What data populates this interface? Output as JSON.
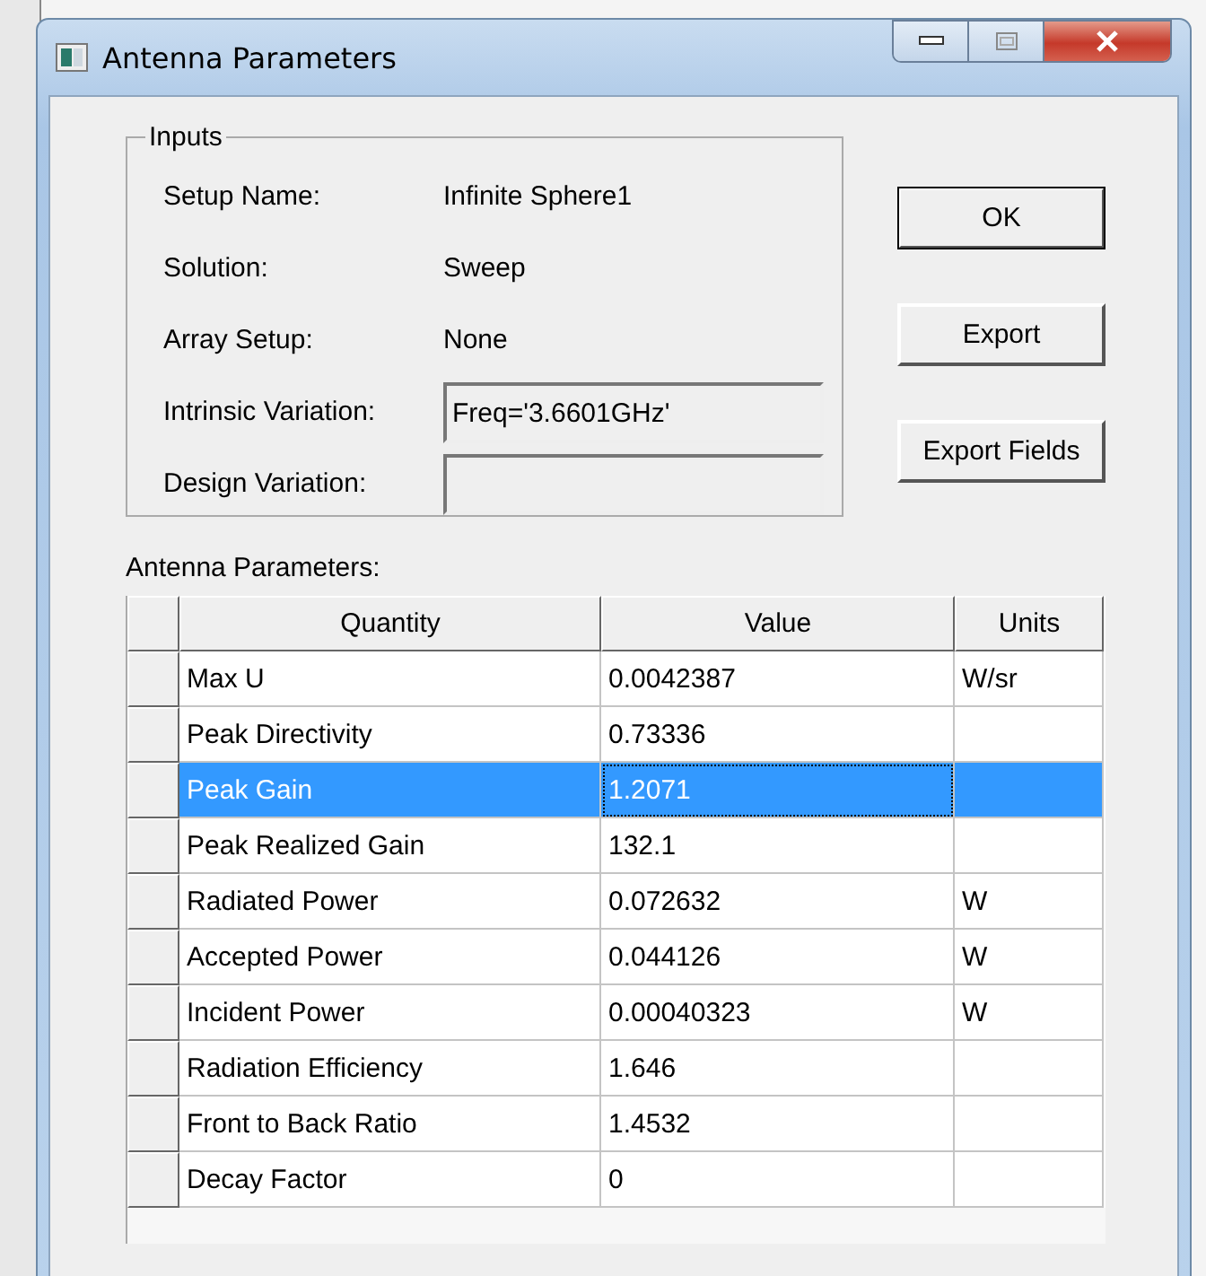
{
  "window": {
    "title": "Antenna Parameters"
  },
  "inputs": {
    "title": "Inputs",
    "items": [
      {
        "kind": "text",
        "label": "Setup Name:",
        "value": "Infinite Sphere1"
      },
      {
        "kind": "text",
        "label": "Solution:",
        "value": "Sweep"
      },
      {
        "kind": "text",
        "label": "Array Setup:",
        "value": "None"
      },
      {
        "kind": "field",
        "label": "Intrinsic Variation:",
        "value": "Freq='3.6601GHz'"
      },
      {
        "kind": "field",
        "label": "Design Variation:"
      }
    ]
  },
  "buttons": [
    "OK",
    "Export",
    "Export Fields"
  ],
  "table": {
    "caption": "Antenna Parameters:",
    "columns": [
      "Quantity",
      "Value",
      "Units"
    ],
    "rows": [
      {
        "cells": [
          "Max U",
          "0.0042387",
          "W/sr"
        ],
        "selected": false
      },
      {
        "cells": [
          "Peak Directivity",
          "0.73336",
          ""
        ],
        "selected": false
      },
      {
        "cells": [
          "Peak Gain",
          "1.2071",
          ""
        ],
        "selected": true
      },
      {
        "cells": [
          "Peak Realized Gain",
          "132.1",
          ""
        ],
        "selected": false
      },
      {
        "cells": [
          "Radiated Power",
          "0.072632",
          "W"
        ],
        "selected": false
      },
      {
        "cells": [
          "Accepted Power",
          "0.044126",
          "W"
        ],
        "selected": false
      },
      {
        "cells": [
          "Incident Power",
          "0.00040323",
          "W"
        ],
        "selected": false
      },
      {
        "cells": [
          "Radiation Efficiency",
          "1.646",
          ""
        ],
        "selected": false
      },
      {
        "cells": [
          "Front to Back Ratio",
          "1.4532",
          ""
        ],
        "selected": false
      },
      {
        "cells": [
          "Decay Factor",
          "0",
          ""
        ],
        "selected": false
      }
    ]
  }
}
